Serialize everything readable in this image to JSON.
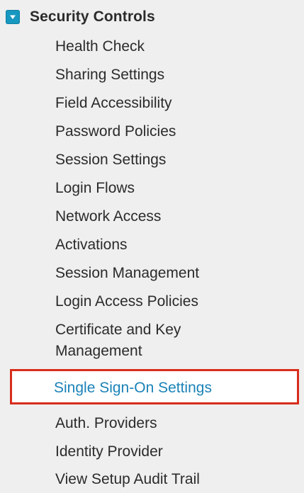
{
  "section": {
    "title": "Security Controls",
    "expanded": true,
    "toggle_icon": "chevron-down-icon",
    "accent_color": "#1798c1"
  },
  "items": [
    {
      "label": "Health Check"
    },
    {
      "label": "Sharing Settings"
    },
    {
      "label": "Field Accessibility"
    },
    {
      "label": "Password Policies"
    },
    {
      "label": "Session Settings"
    },
    {
      "label": "Login Flows"
    },
    {
      "label": "Network Access"
    },
    {
      "label": "Activations"
    },
    {
      "label": "Session Management"
    },
    {
      "label": "Login Access Policies"
    },
    {
      "label": "Certificate and Key Management"
    },
    {
      "label": "Single Sign-On Settings",
      "selected": true,
      "highlight_color": "#d82d1c"
    },
    {
      "label": "Auth. Providers"
    },
    {
      "label": "Identity Provider"
    },
    {
      "label": "View Setup Audit Trail"
    }
  ]
}
